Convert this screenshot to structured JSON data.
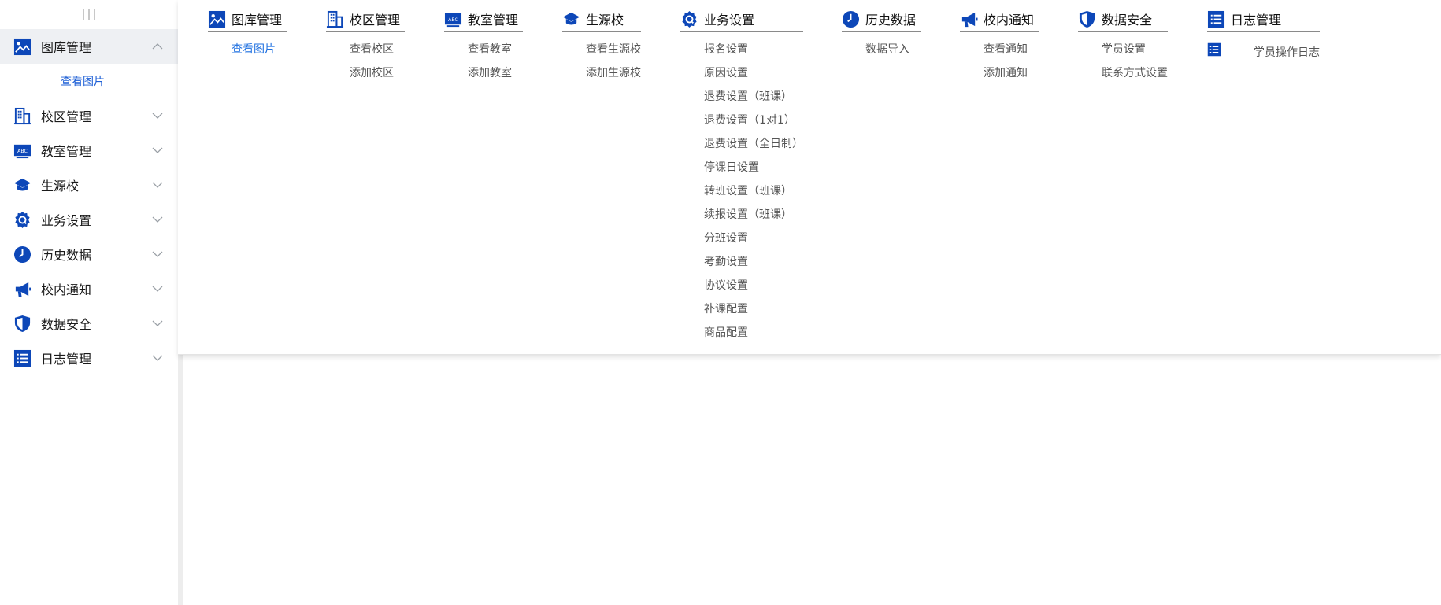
{
  "colors": {
    "accent": "#0d47b8",
    "link": "#1d6fe0",
    "sidebar_active_bg": "#eef0f3"
  },
  "sidebar": {
    "items": [
      {
        "label": "图库管理",
        "icon": "image-icon",
        "expanded": true,
        "children": [
          "查看图片"
        ]
      },
      {
        "label": "校区管理",
        "icon": "building-icon",
        "expanded": false
      },
      {
        "label": "教室管理",
        "icon": "classroom-board-icon",
        "expanded": false
      },
      {
        "label": "生源校",
        "icon": "graduation-cap-icon",
        "expanded": false
      },
      {
        "label": "业务设置",
        "icon": "gear-icon",
        "expanded": false
      },
      {
        "label": "历史数据",
        "icon": "clock-icon",
        "expanded": false
      },
      {
        "label": "校内通知",
        "icon": "megaphone-icon",
        "expanded": false
      },
      {
        "label": "数据安全",
        "icon": "shield-icon",
        "expanded": false
      },
      {
        "label": "日志管理",
        "icon": "list-icon",
        "expanded": false
      }
    ]
  },
  "mega_menu": {
    "columns": [
      {
        "title": "图库管理",
        "icon": "image-icon",
        "items": [
          "查看图片"
        ]
      },
      {
        "title": "校区管理",
        "icon": "building-icon",
        "items": [
          "查看校区",
          "添加校区"
        ]
      },
      {
        "title": "教室管理",
        "icon": "classroom-board-icon",
        "items": [
          "查看教室",
          "添加教室"
        ]
      },
      {
        "title": "生源校",
        "icon": "graduation-cap-icon",
        "items": [
          "查看生源校",
          "添加生源校"
        ]
      },
      {
        "title": "业务设置",
        "icon": "gear-icon",
        "items": [
          "报名设置",
          "原因设置",
          "退费设置（班课）",
          "退费设置（1对1）",
          "退费设置（全日制）",
          "停课日设置",
          "转班设置（班课）",
          "续报设置（班课）",
          "分班设置",
          "考勤设置",
          "协议设置",
          "补课配置",
          "商品配置"
        ]
      },
      {
        "title": "历史数据",
        "icon": "clock-icon",
        "items": [
          "数据导入"
        ]
      },
      {
        "title": "校内通知",
        "icon": "megaphone-icon",
        "items": [
          "查看通知",
          "添加通知"
        ]
      },
      {
        "title": "数据安全",
        "icon": "shield-icon",
        "items": [
          "学员设置",
          "联系方式设置"
        ]
      },
      {
        "title": "日志管理",
        "icon": "list-icon",
        "items": [
          "学员操作日志"
        ]
      }
    ],
    "active_item": "查看图片"
  }
}
